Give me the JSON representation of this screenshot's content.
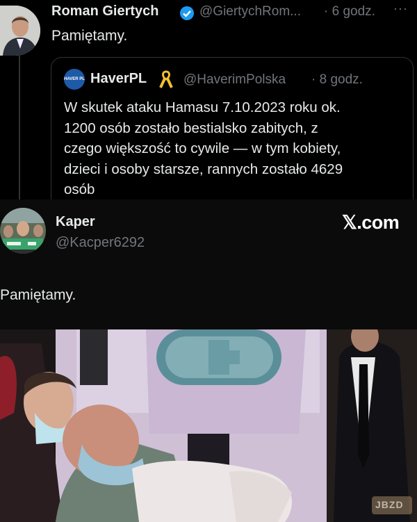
{
  "tweet": {
    "author_name": "Roman Giertych",
    "author_handle": "@GiertychRom...",
    "time": "· 6 godz.",
    "more": "···",
    "text": "Pamiętamy."
  },
  "quoted": {
    "badge_text": "HAVER PL",
    "author_name": "HaverPL",
    "author_handle": "@HaverimPolska",
    "time": "· 8 godz.",
    "lines": [
      "W skutek ataku Hamasu  7.10.2023 roku  ok.",
      "1200 osób zostało bestialsko zabitych, z",
      "czego większość to cywile — w tym kobiety,",
      "dzieci i osoby starsze, rannych zostało 4629",
      "osób"
    ]
  },
  "reply": {
    "author_name": "Kaper",
    "author_handle": "@Kacper6292",
    "brand": "𝕏.com",
    "text": "Pamiętamy.",
    "watermark": "JBZD"
  },
  "colors": {
    "background": "#000000",
    "text": "#e7e9ea",
    "muted": "#71767b",
    "verified": "#1d9bf0",
    "ribbon": "#f2c12e"
  }
}
